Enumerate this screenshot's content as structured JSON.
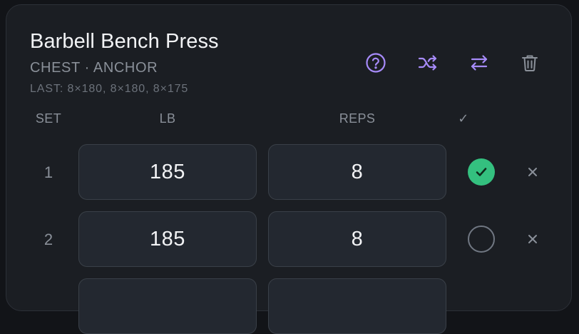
{
  "exercise": {
    "title": "Barbell Bench Press",
    "subtitle": "CHEST · ANCHOR",
    "last": "LAST: 8×180, 8×180, 8×175"
  },
  "toolbar": {
    "icons": [
      "help-icon",
      "shuffle-icon",
      "swap-icon",
      "trash-icon"
    ],
    "accent_color": "#a78bfa"
  },
  "columns": {
    "set": "SET",
    "lb": "LB",
    "reps": "REPS",
    "done": "✓"
  },
  "sets": [
    {
      "set": "1",
      "lb": "185",
      "reps": "8",
      "done": true
    },
    {
      "set": "2",
      "lb": "185",
      "reps": "8",
      "done": false
    },
    {
      "set": "",
      "lb": "",
      "reps": "",
      "done": false
    }
  ],
  "colors": {
    "done": "#34c07f",
    "card": "#1b1e23",
    "field": "#232830"
  }
}
